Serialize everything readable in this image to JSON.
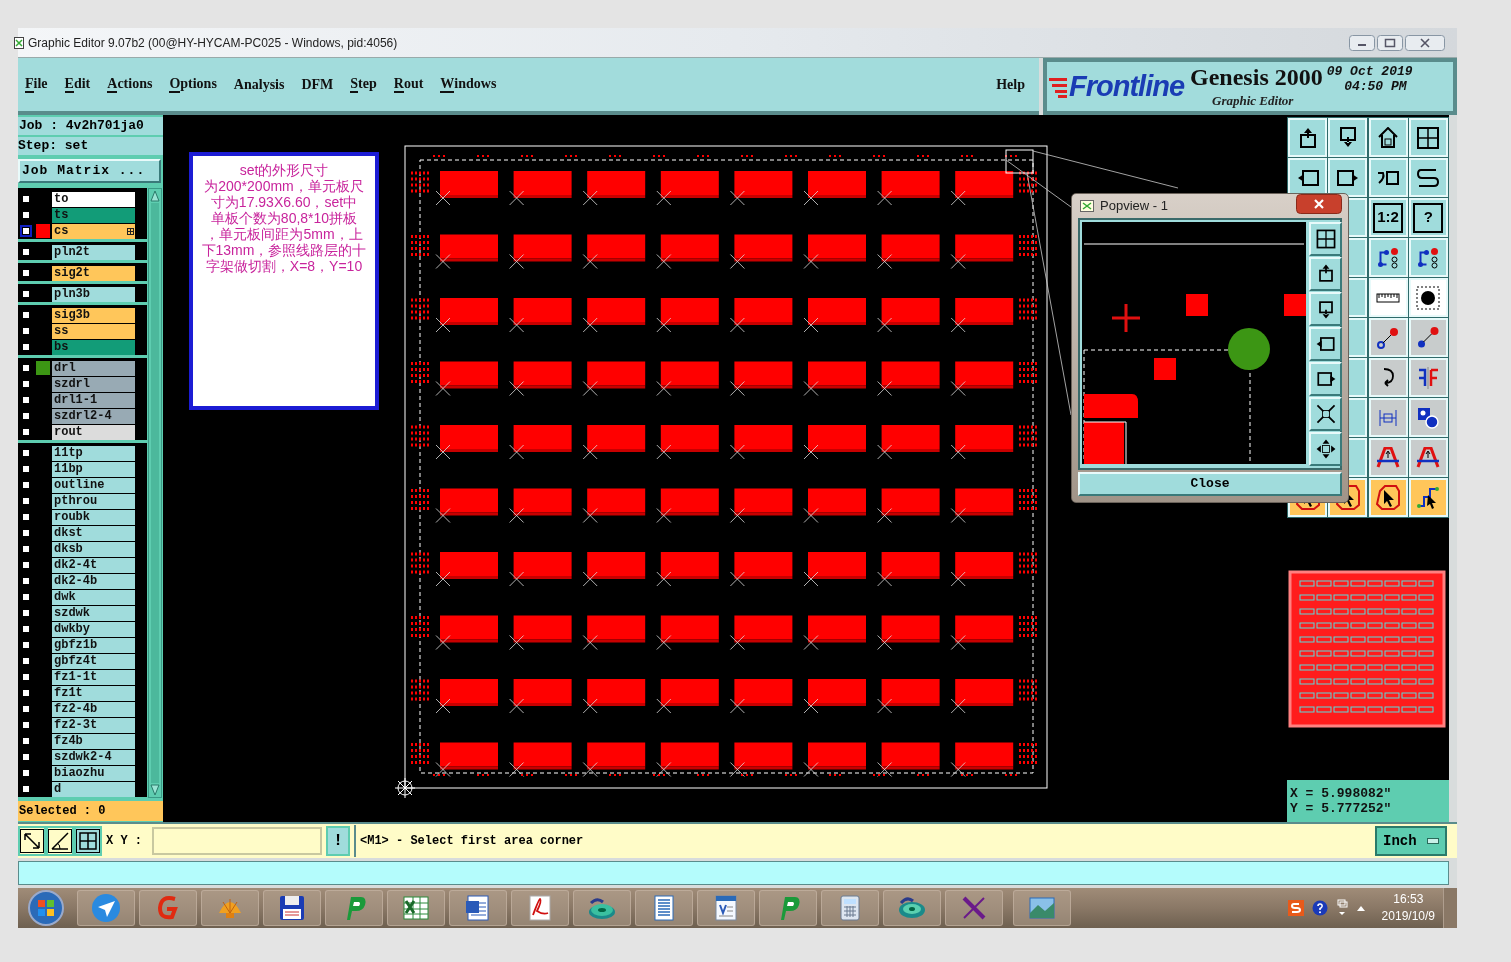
{
  "window": {
    "title": "Graphic Editor 9.07b2 (00@HY-HYCAM-PC025 - Windows, pid:4056)"
  },
  "menu": [
    {
      "label": "File",
      "underlined": true
    },
    {
      "label": "Edit",
      "underlined": true
    },
    {
      "label": "Actions",
      "underlined": true
    },
    {
      "label": "Options",
      "underlined": true
    },
    {
      "label": "Analysis",
      "underlined": false
    },
    {
      "label": "DFM",
      "underlined": false
    },
    {
      "label": "Step",
      "underlined": true
    },
    {
      "label": "Rout",
      "underlined": true
    },
    {
      "label": "Windows",
      "underlined": true
    }
  ],
  "help_menu": {
    "label": "Help"
  },
  "brand": {
    "logo": "Frontline",
    "product": "Genesis 2000",
    "subtitle": "Graphic Editor",
    "date": "09 Oct 2019",
    "time": "04:50 PM"
  },
  "job": "Job : 4v2h701ja0",
  "step": "Step: set",
  "job_matrix_button": "Job Matrix ...",
  "layer_groups": [
    {
      "layers": [
        {
          "name": "to",
          "color": "#ffffff",
          "checked": false,
          "selected": false
        },
        {
          "name": "ts",
          "color": "#129c78",
          "checked": false,
          "selected": false
        },
        {
          "name": "cs",
          "color": "#ffc65a",
          "checked": false,
          "selected": true,
          "swatch": {
            "color": "#ff0000"
          }
        }
      ]
    },
    {
      "layers": [
        {
          "name": "pln2t",
          "color": "#a0dcdc",
          "checked": false,
          "selected": false
        }
      ]
    },
    {
      "layers": [
        {
          "name": "sig2t",
          "color": "#ffc65a",
          "checked": false,
          "selected": false
        }
      ]
    },
    {
      "layers": [
        {
          "name": "pln3b",
          "color": "#a0dcdc",
          "checked": false,
          "selected": false
        }
      ]
    },
    {
      "layers": [
        {
          "name": "sig3b",
          "color": "#ffc65a",
          "checked": false,
          "selected": false
        },
        {
          "name": "ss",
          "color": "#ffc65a",
          "checked": false,
          "selected": false
        },
        {
          "name": "bs",
          "color": "#129c78",
          "checked": false,
          "selected": false
        }
      ]
    },
    {
      "layers": [
        {
          "name": "drl",
          "color": "#98aab4",
          "checked": false,
          "selected": false,
          "swatch": {
            "color": "#3c9614"
          }
        },
        {
          "name": "szdrl",
          "color": "#98aab4",
          "checked": false,
          "selected": false
        },
        {
          "name": "drl1-1",
          "color": "#98aab4",
          "checked": false,
          "selected": false
        },
        {
          "name": "szdrl2-4",
          "color": "#98aab4",
          "checked": false,
          "selected": false
        },
        {
          "name": "rout",
          "color": "#dcdcdc",
          "checked": false,
          "selected": false
        }
      ]
    },
    {
      "layers": [
        {
          "name": "11tp",
          "color": "#a0dcdc",
          "checked": false,
          "selected": false
        },
        {
          "name": "11bp",
          "color": "#a0dcdc",
          "checked": false,
          "selected": false
        },
        {
          "name": "outline",
          "color": "#a0dcdc",
          "checked": false,
          "selected": false
        },
        {
          "name": "pthrou",
          "color": "#a0dcdc",
          "checked": false,
          "selected": false
        },
        {
          "name": "roubk",
          "color": "#a0dcdc",
          "checked": false,
          "selected": false
        },
        {
          "name": "dkst",
          "color": "#a0dcdc",
          "checked": false,
          "selected": false
        },
        {
          "name": "dksb",
          "color": "#a0dcdc",
          "checked": false,
          "selected": false
        },
        {
          "name": "dk2-4t",
          "color": "#a0dcdc",
          "checked": false,
          "selected": false
        },
        {
          "name": "dk2-4b",
          "color": "#a0dcdc",
          "checked": false,
          "selected": false
        },
        {
          "name": "dwk",
          "color": "#a0dcdc",
          "checked": false,
          "selected": false
        },
        {
          "name": "szdwk",
          "color": "#a0dcdc",
          "checked": false,
          "selected": false
        },
        {
          "name": "dwkby",
          "color": "#a0dcdc",
          "checked": false,
          "selected": false
        },
        {
          "name": "gbfz1b",
          "color": "#a0dcdc",
          "checked": false,
          "selected": false
        },
        {
          "name": "gbfz4t",
          "color": "#a0dcdc",
          "checked": false,
          "selected": false
        },
        {
          "name": "fz1-1t",
          "color": "#a0dcdc",
          "checked": false,
          "selected": false
        },
        {
          "name": "fz1t",
          "color": "#a0dcdc",
          "checked": false,
          "selected": false
        },
        {
          "name": "fz2-4b",
          "color": "#a0dcdc",
          "checked": false,
          "selected": false
        },
        {
          "name": "fz2-3t",
          "color": "#a0dcdc",
          "checked": false,
          "selected": false
        },
        {
          "name": "fz4b",
          "color": "#a0dcdc",
          "checked": false,
          "selected": false
        },
        {
          "name": "szdwk2-4",
          "color": "#a0dcdc",
          "checked": false,
          "selected": false
        },
        {
          "name": "biaozhu",
          "color": "#a0dcdc",
          "checked": false,
          "selected": false
        },
        {
          "name": "d",
          "color": "#a0dcdc",
          "checked": false,
          "selected": false
        }
      ]
    }
  ],
  "selected_count": "Selected : 0",
  "note": {
    "lines": [
      "set的外形尺寸",
      "为200*200mm，单元板尺",
      "寸为17.93X6.60，set中",
      "单板个数为80,8*10拼板",
      "，单元板间距为5mm，上",
      "下13mm，参照线路层的十",
      "字架做切割，X=8，Y=10"
    ]
  },
  "popview": {
    "title": "Popview - 1",
    "close_button": "Close"
  },
  "toolbar": {
    "scale_button": "1:2",
    "help_button": "?"
  },
  "readout": {
    "x": "X = 5.998082\"",
    "y": "Y = 5.777252\""
  },
  "units_button": "Inch",
  "command": {
    "xy_label": "X Y :",
    "alert_button": "!",
    "prompt": "<M1> - Select first area corner"
  },
  "clock": {
    "time": "16:53",
    "date": "2019/10/9"
  }
}
